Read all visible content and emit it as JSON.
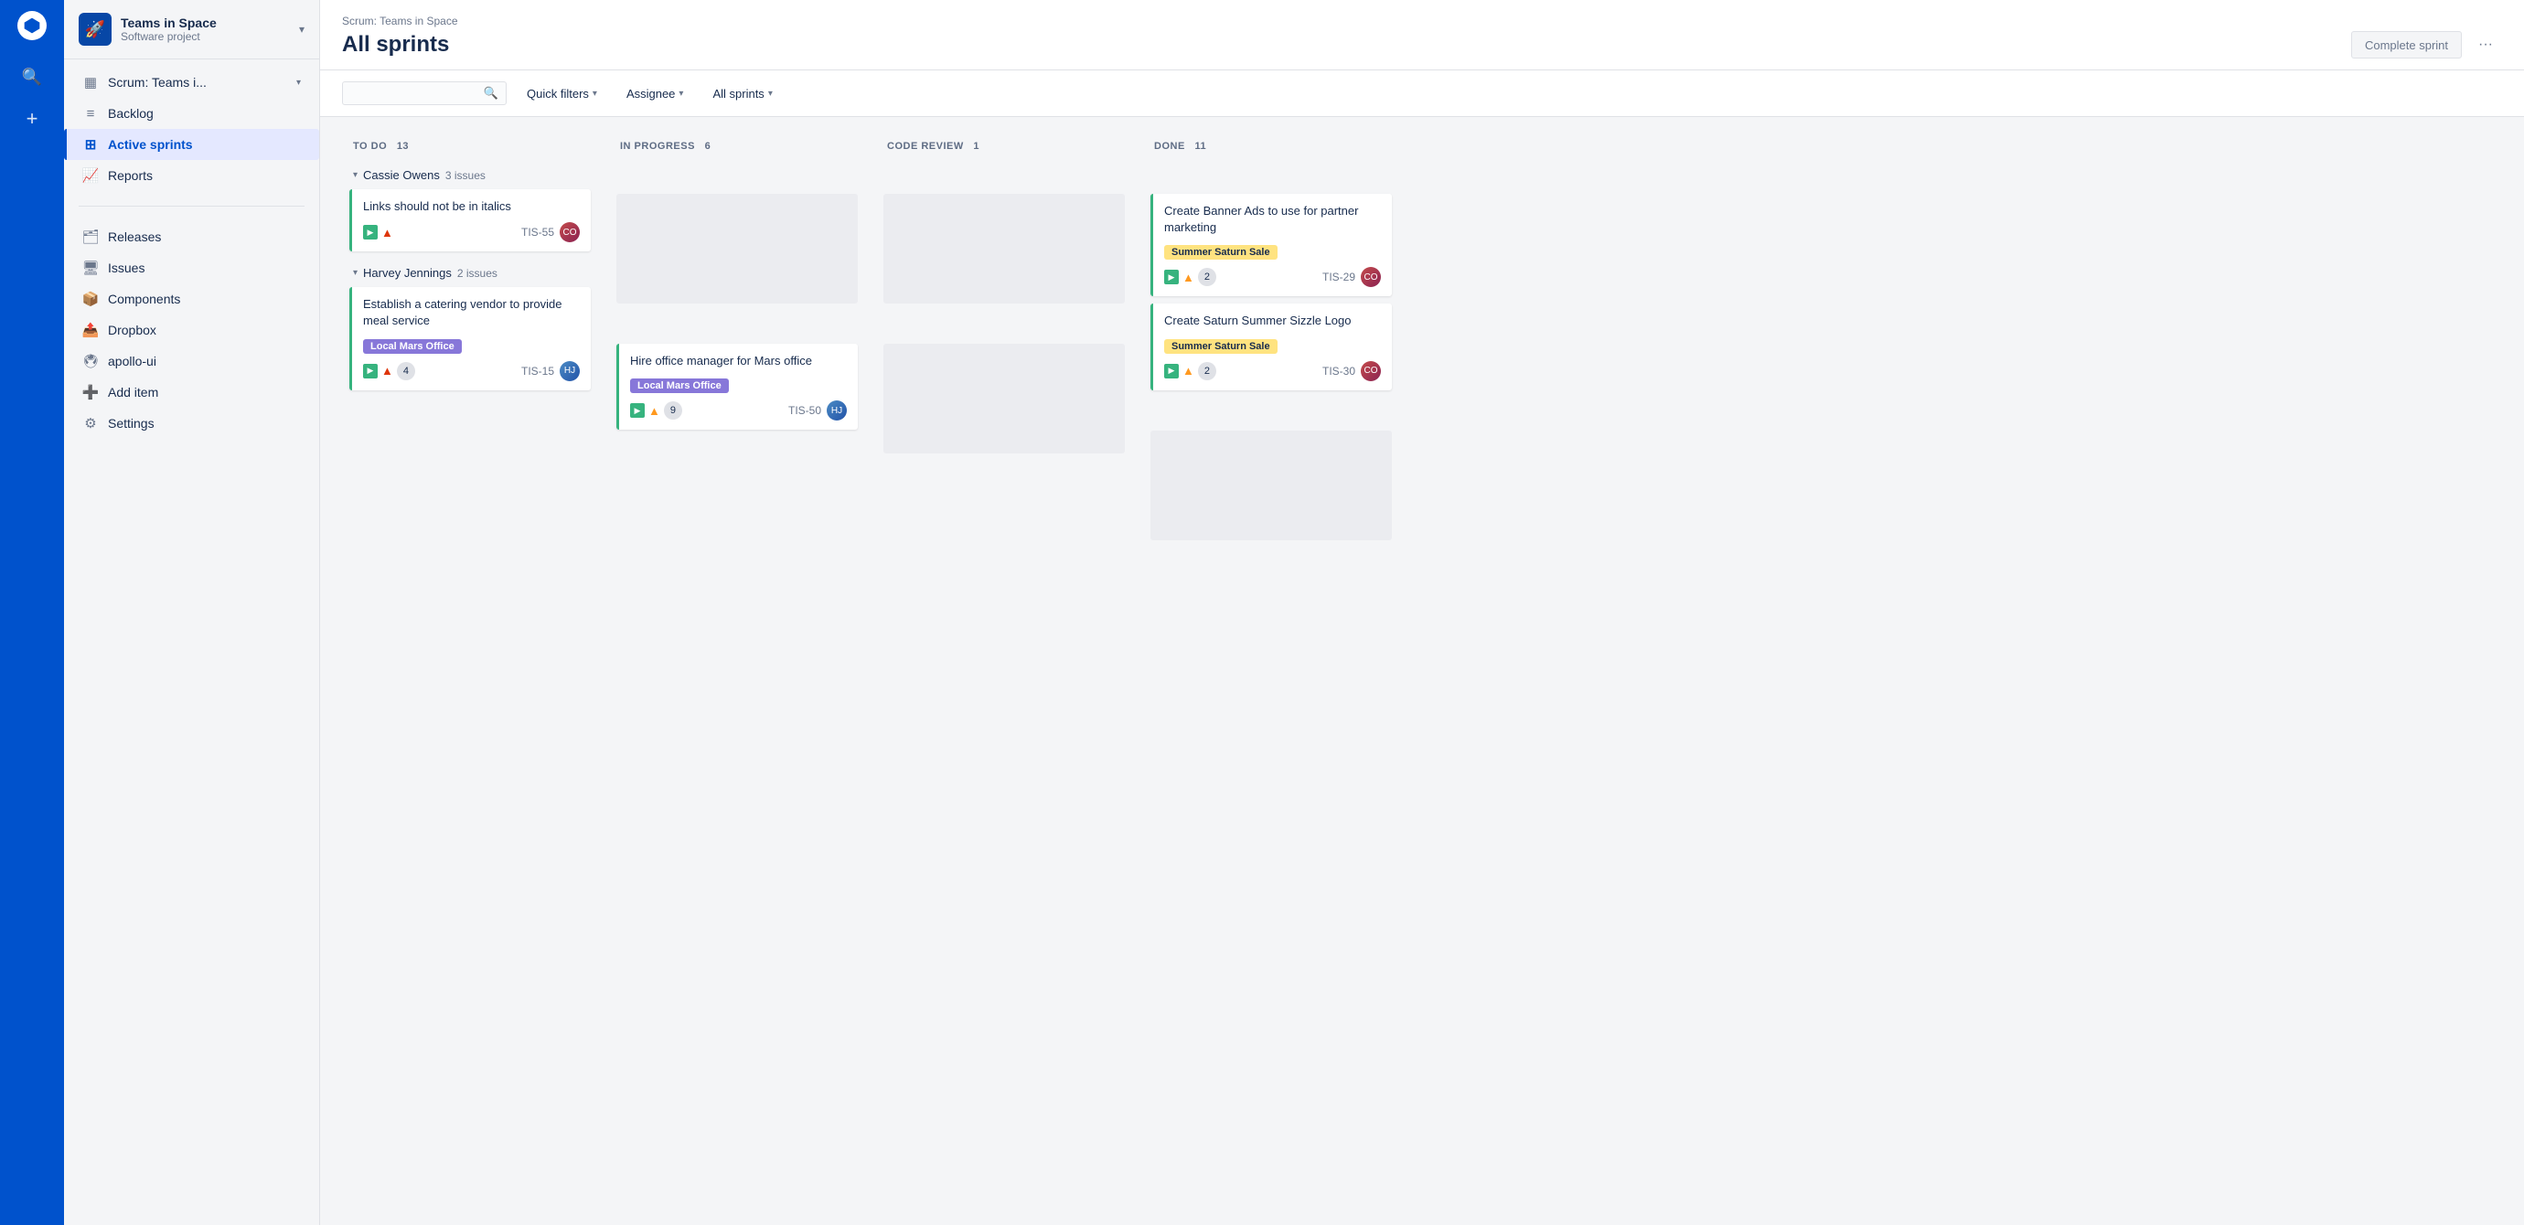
{
  "app": {
    "logo_text": "◆"
  },
  "icon_bar": {
    "icons": [
      "◆",
      "🔍",
      "+"
    ]
  },
  "sidebar": {
    "project": {
      "name": "Teams in Space",
      "type": "Software project",
      "chevron": "▾"
    },
    "nav_items": [
      {
        "id": "scrum",
        "label": "Scrum: Teams i...",
        "icon": "▦",
        "has_chevron": true,
        "active": false
      },
      {
        "id": "backlog",
        "label": "Backlog",
        "icon": "≡",
        "active": false
      },
      {
        "id": "active-sprints",
        "label": "Active sprints",
        "icon": "⊞",
        "active": true
      }
    ],
    "nav_items2": [
      {
        "id": "reports",
        "label": "Reports",
        "icon": "📈",
        "active": false
      }
    ],
    "nav_items3": [
      {
        "id": "releases",
        "label": "Releases",
        "icon": "🗂",
        "active": false
      },
      {
        "id": "issues",
        "label": "Issues",
        "icon": "🖥",
        "active": false
      },
      {
        "id": "components",
        "label": "Components",
        "icon": "📦",
        "active": false
      },
      {
        "id": "dropbox",
        "label": "Dropbox",
        "icon": "📤",
        "active": false
      },
      {
        "id": "apollo-ui",
        "label": "apollo-ui",
        "icon": "🖲",
        "active": false
      },
      {
        "id": "add-item",
        "label": "Add item",
        "icon": "➕",
        "active": false
      },
      {
        "id": "settings",
        "label": "Settings",
        "icon": "⚙",
        "active": false
      }
    ]
  },
  "header": {
    "breadcrumb": "Scrum: Teams in Space",
    "title": "All sprints",
    "complete_sprint_label": "Complete sprint",
    "more_label": "···"
  },
  "toolbar": {
    "search_placeholder": "",
    "quick_filters_label": "Quick filters",
    "assignee_label": "Assignee",
    "all_sprints_label": "All sprints"
  },
  "columns": [
    {
      "id": "todo",
      "label": "TO DO",
      "count": 13
    },
    {
      "id": "inprogress",
      "label": "IN PROGRESS",
      "count": 6
    },
    {
      "id": "codereview",
      "label": "CODE REVIEW",
      "count": 1
    },
    {
      "id": "done",
      "label": "DONE",
      "count": 11
    }
  ],
  "groups": [
    {
      "id": "cassie",
      "name": "Cassie Owens",
      "issue_count": 3,
      "issue_label": "issues",
      "cards": {
        "todo": [
          {
            "id": "TIS-55",
            "title": "Links should not be in italics",
            "tag": null,
            "icons": [
              "story",
              "priority-red"
            ],
            "badge": null,
            "avatar": "cassie"
          }
        ],
        "inprogress": [],
        "codereview": [],
        "done": [
          {
            "id": "TIS-29",
            "title": "Create Banner Ads to use for partner marketing",
            "tag": "Summer Saturn Sale",
            "tag_class": "tag-summer",
            "icons": [
              "story",
              "priority-orange"
            ],
            "badge": 2,
            "avatar": "cassie2"
          },
          {
            "id": "TIS-30",
            "title": "Create Saturn Summer Sizzle Logo",
            "tag": "Summer Saturn Sale",
            "tag_class": "tag-summer",
            "icons": [
              "story",
              "priority-orange"
            ],
            "badge": 2,
            "avatar": "cassie2"
          }
        ]
      }
    },
    {
      "id": "harvey",
      "name": "Harvey Jennings",
      "issue_count": 2,
      "issue_label": "issues",
      "cards": {
        "todo": [
          {
            "id": "TIS-15",
            "title": "Establish a catering vendor to provide meal service",
            "tag": "Local Mars Office",
            "tag_class": "tag-mars",
            "icons": [
              "story",
              "priority-red"
            ],
            "badge": 4,
            "avatar": "harvey"
          }
        ],
        "inprogress": [
          {
            "id": "TIS-50",
            "title": "Hire office manager for Mars office",
            "tag": "Local Mars Office",
            "tag_class": "tag-mars",
            "icons": [
              "story",
              "priority-orange"
            ],
            "badge": 9,
            "avatar": "harvey"
          }
        ],
        "codereview": [],
        "done": []
      }
    }
  ]
}
